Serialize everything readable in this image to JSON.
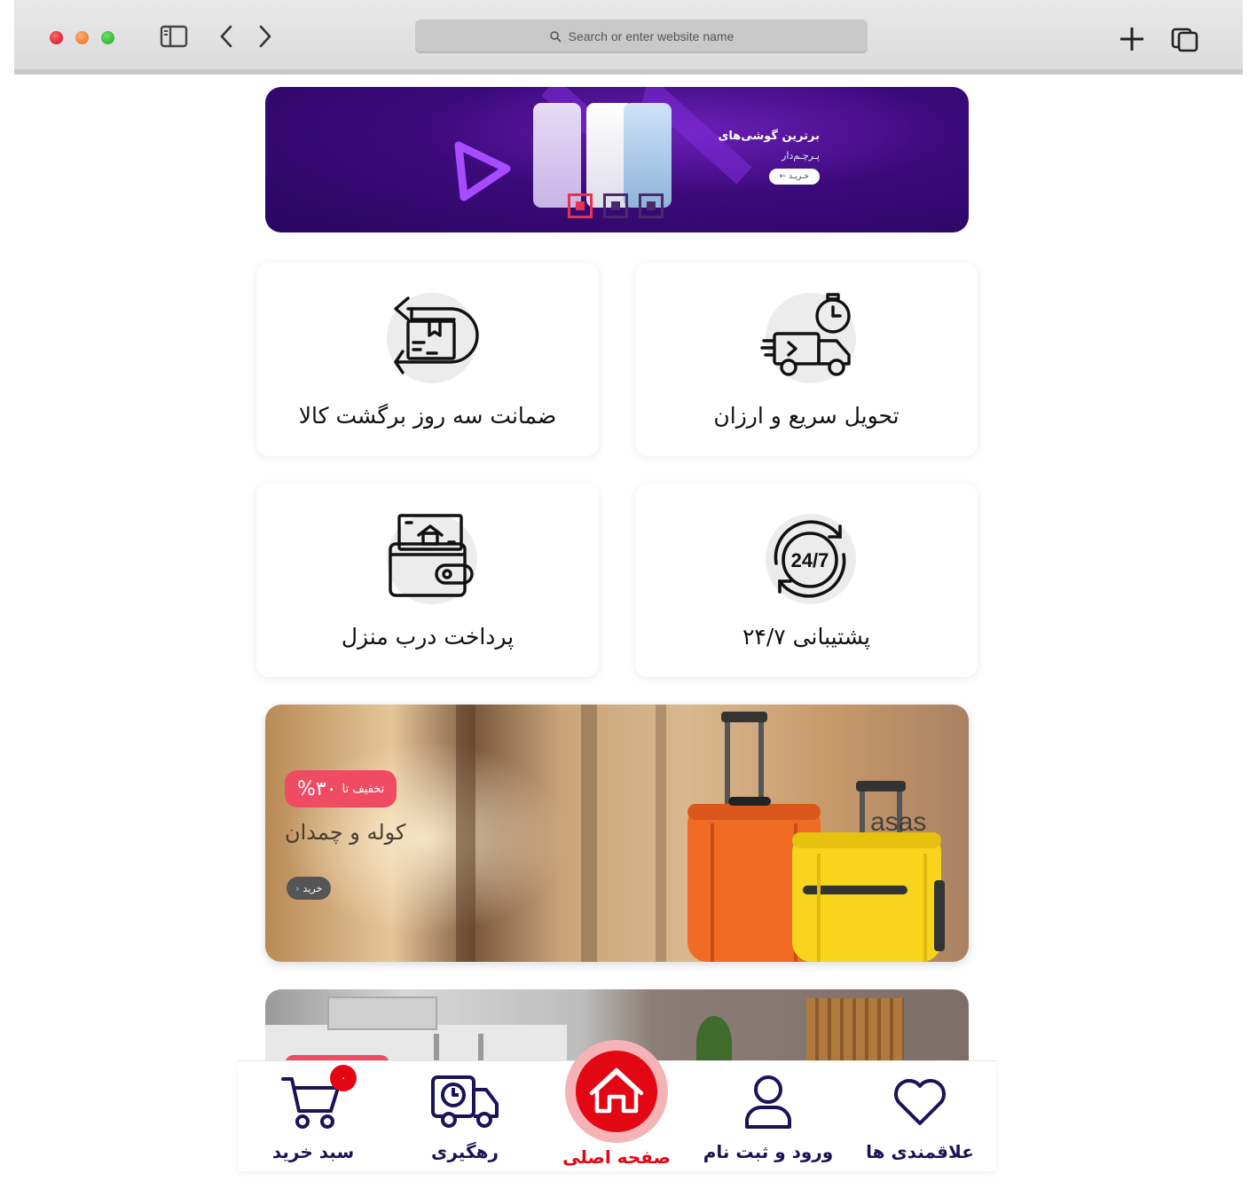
{
  "browser": {
    "url_placeholder": "Search or enter website name"
  },
  "hero": {
    "title": "برترین گوشی‌های",
    "subtitle": "پـرچـم‌دار",
    "button": "خـریـد",
    "indicator_count": 3,
    "active_indicator": 1
  },
  "features": [
    {
      "label": "تحویل سریع و ارزان",
      "icon": "delivery-truck-icon"
    },
    {
      "label": "ضمانت سه روز برگشت کالا",
      "icon": "return-box-icon"
    },
    {
      "label": "پشتیبانی ۲۴/۷",
      "icon": "support-24-7-icon",
      "icon_text": "24/7"
    },
    {
      "label": "پرداخت درب منزل",
      "icon": "wallet-icon"
    }
  ],
  "promo": {
    "discount_prefix": "تخفیف تا",
    "discount_value": "%۳۰",
    "title": "کوله و چمدان",
    "button": "خرید",
    "watermark": "asas"
  },
  "bottom_nav": {
    "items": [
      {
        "label": "علاقمندی ها",
        "icon": "heart-icon"
      },
      {
        "label": "ورود و ثبت نام",
        "icon": "user-icon"
      },
      {
        "label": "صفحه اصلی",
        "icon": "home-icon",
        "active": true
      },
      {
        "label": "رهگیری",
        "icon": "tracking-truck-icon"
      },
      {
        "label": "سبد خرید",
        "icon": "cart-icon",
        "badge": "۰"
      }
    ]
  },
  "colors": {
    "accent_red": "#e30613",
    "nav_text": "#1b1358",
    "hero_purple": "#3b0a7a",
    "discount_pink": "#ef4c63"
  }
}
